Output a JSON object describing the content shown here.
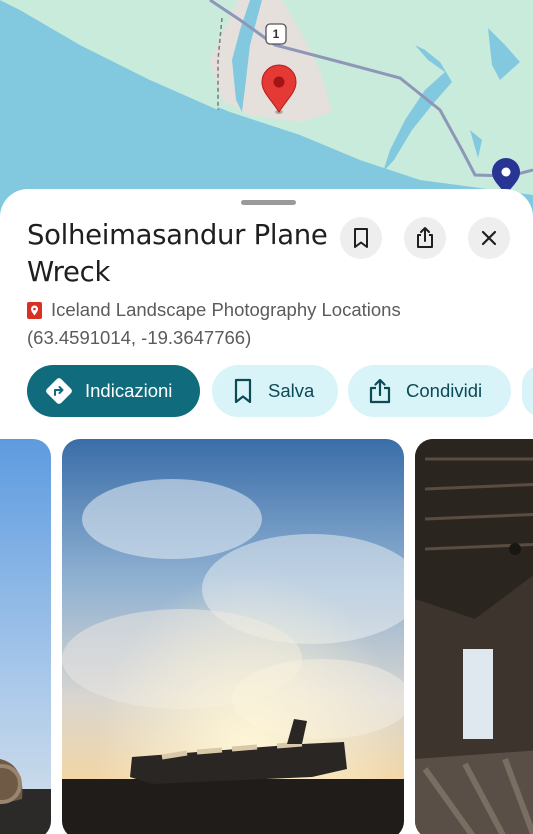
{
  "map": {
    "road_number": "1",
    "colors": {
      "water": "#82c9e0",
      "land": "#c8ebdc",
      "place_area": "#e6e0dc",
      "road": "#8e97b8",
      "pin": "#e53935",
      "pin_secondary": "#283593"
    }
  },
  "place": {
    "title": "Solheimasandur Plane Wreck",
    "list_name": "Iceland Landscape Photography Locations",
    "coordinates": "(63.4591014, -19.3647766)"
  },
  "header_actions": {
    "save_icon": "bookmark-icon",
    "share_icon": "share-icon",
    "close_icon": "close-icon"
  },
  "actions": {
    "directions": "Indicazioni",
    "save": "Salva",
    "share": "Condividi"
  },
  "colors": {
    "primary_chip": "#106b7c",
    "secondary_chip": "#d8f4f9",
    "secondary_text": "#0c4a56",
    "list_pin": "#d93025"
  }
}
